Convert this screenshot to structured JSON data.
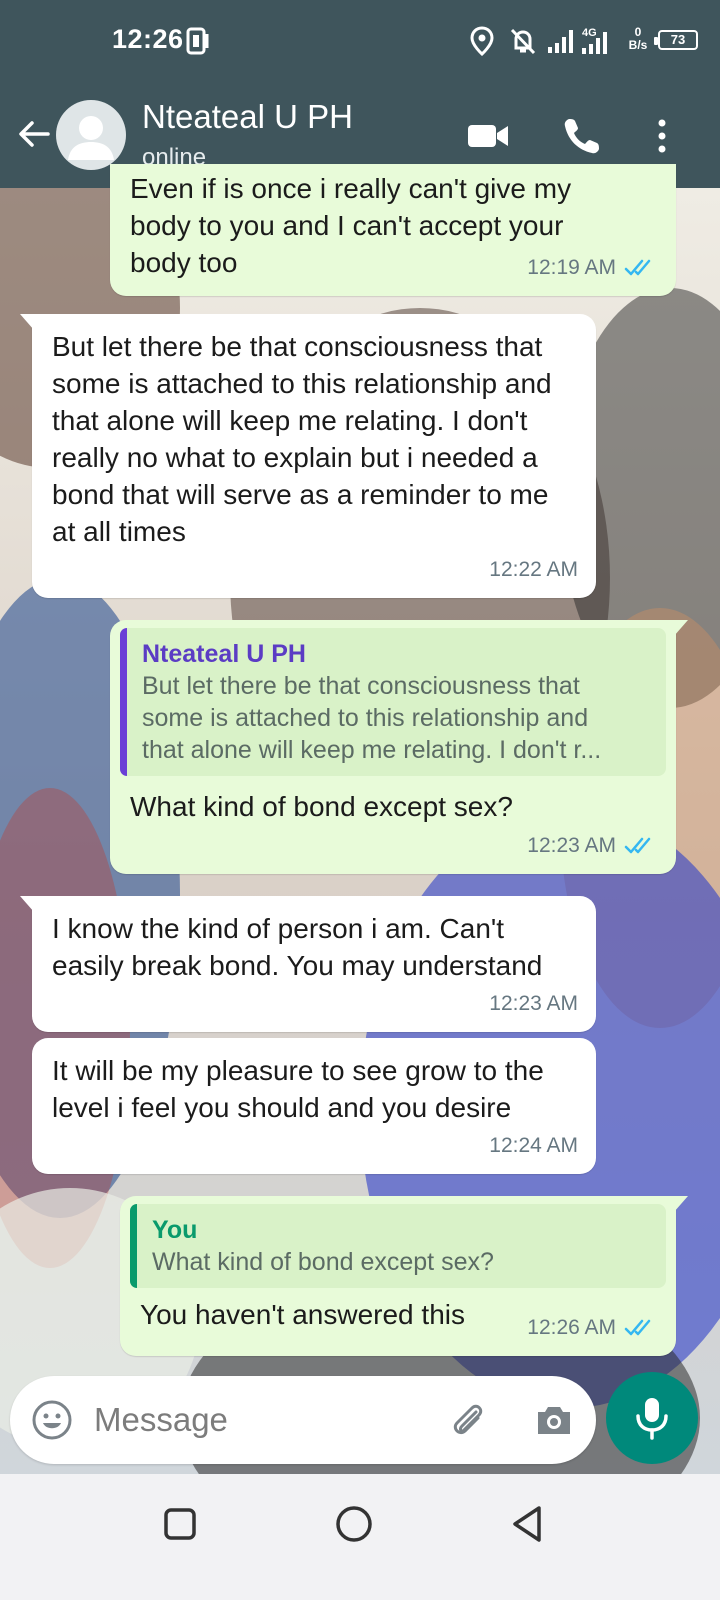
{
  "status_bar": {
    "time": "12:26",
    "network": "4G",
    "net_speed_value": "0",
    "net_speed_unit": "B/s",
    "battery": "73",
    "icons": [
      "nfc-icon",
      "location-icon",
      "mute-bell-icon",
      "signal-icon",
      "signal-icon-4g",
      "battery-icon"
    ]
  },
  "header": {
    "contact_name": "Nteateal U PH",
    "contact_status": "online",
    "icons": [
      "back-arrow-icon",
      "avatar-icon",
      "video-call-icon",
      "phone-icon",
      "more-vert-icon"
    ]
  },
  "messages": [
    {
      "direction": "out",
      "text_lines": [
        "Even if is once i really can't give my",
        "body to you and I can't accept your",
        "body too"
      ],
      "time": "12:19 AM",
      "read": true
    },
    {
      "direction": "in",
      "text": "But let there be that consciousness that some is attached to this relationship and that alone will keep me relating. I don't really no what to explain but i needed a bond that will serve as a reminder to me at all times",
      "time": "12:22 AM"
    },
    {
      "direction": "out",
      "quote": {
        "author": "Nteateal U PH",
        "lines": [
          "But let there be that consciousness that",
          "some is attached to this relationship and",
          "that alone will keep me relating. I don't r..."
        ]
      },
      "text": "What kind of bond except sex?",
      "time": "12:23 AM",
      "read": true
    },
    {
      "direction": "in",
      "text": "I know the kind of person i am. Can't easily break bond. You may understand",
      "time": "12:23 AM"
    },
    {
      "direction": "in",
      "text": "It will be my pleasure to see grow to the level i feel you should and you desire",
      "time": "12:24 AM"
    },
    {
      "direction": "out",
      "quote": {
        "author": "You",
        "lines": [
          "What kind of bond except sex?"
        ]
      },
      "text": "You haven't answered this",
      "time": "12:26 AM",
      "read": true
    }
  ],
  "input": {
    "placeholder": "Message",
    "icons": [
      "emoji-icon",
      "attach-icon",
      "camera-icon",
      "mic-icon"
    ]
  },
  "colors": {
    "header_bg": "#3f555c",
    "outgoing_bubble": "#e8fbd9",
    "incoming_bubble": "#ffffff",
    "read_tick": "#34b7f1",
    "quote_bar_contact": "#6a3fd6",
    "quote_bar_you": "#0a9a6c",
    "mic_button": "#00897b"
  },
  "nav": {
    "icons": [
      "recents-square-icon",
      "home-circle-icon",
      "back-triangle-icon"
    ]
  }
}
